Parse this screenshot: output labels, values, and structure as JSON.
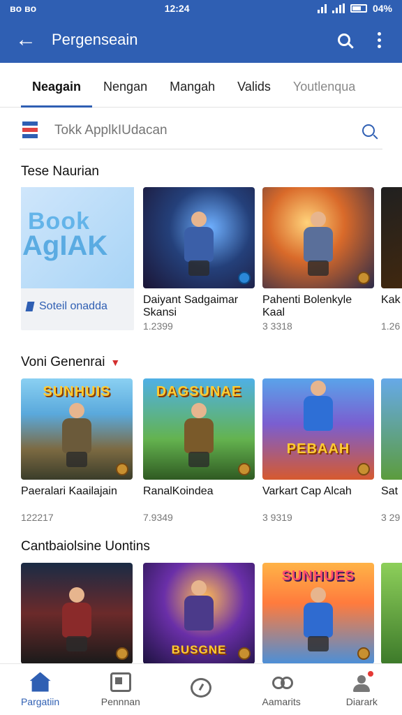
{
  "status": {
    "left": "ʙᴏ ʙᴏ",
    "time": "12:24",
    "battery": "04%"
  },
  "appbar": {
    "title": "Pergenseain"
  },
  "tabs": [
    {
      "label": "Neagain",
      "active": true
    },
    {
      "label": "Nengan"
    },
    {
      "label": "Mangah"
    },
    {
      "label": "Valids"
    },
    {
      "label": "Youtlenqua"
    }
  ],
  "search": {
    "placeholder": "Tokk ApplkIUdacan"
  },
  "sections": [
    {
      "title": "Tese Naurian",
      "promo": {
        "art_line1": "Book",
        "art_line2": "AgIAK",
        "label": "Soteil onadda"
      },
      "items": [
        {
          "title": "Daiyant Sadgaimar Skansi",
          "sub": "1.2399"
        },
        {
          "title": "Pahenti Bolenkyle Kaal",
          "sub": "3 3318"
        },
        {
          "title": "Kak",
          "sub": "1.26"
        }
      ]
    },
    {
      "title": "Voni Genenrai",
      "items": [
        {
          "title": "Paeralari Kaailajain",
          "sub": "122217",
          "art_word": "SUNHUIS"
        },
        {
          "title": "RanalKoindea",
          "sub": "7.9349",
          "art_word": "DAGSUNAE"
        },
        {
          "title": "Varkart Cap Alcah",
          "sub": "3 9319",
          "art_word": "PEBAAH"
        },
        {
          "title": "Sat",
          "sub": "3 29"
        }
      ]
    },
    {
      "title": "Cantbaiolsine Uontins",
      "items": [
        {
          "title": ""
        },
        {
          "title": "",
          "art_word": "BUSGNE"
        },
        {
          "title": "",
          "art_word": "SUNHUES"
        },
        {
          "title": ""
        }
      ]
    }
  ],
  "bottomnav": [
    {
      "label": "Pargatiin",
      "icon": "home-icon",
      "active": true
    },
    {
      "label": "Pennnan",
      "icon": "apps-icon"
    },
    {
      "label": "",
      "icon": "clock-icon"
    },
    {
      "label": "Aamarits",
      "icon": "games-icon"
    },
    {
      "label": "Diarark",
      "icon": "profile-icon"
    }
  ],
  "colors": {
    "primary": "#2f5fb3",
    "accent_red": "#d32f2f"
  }
}
